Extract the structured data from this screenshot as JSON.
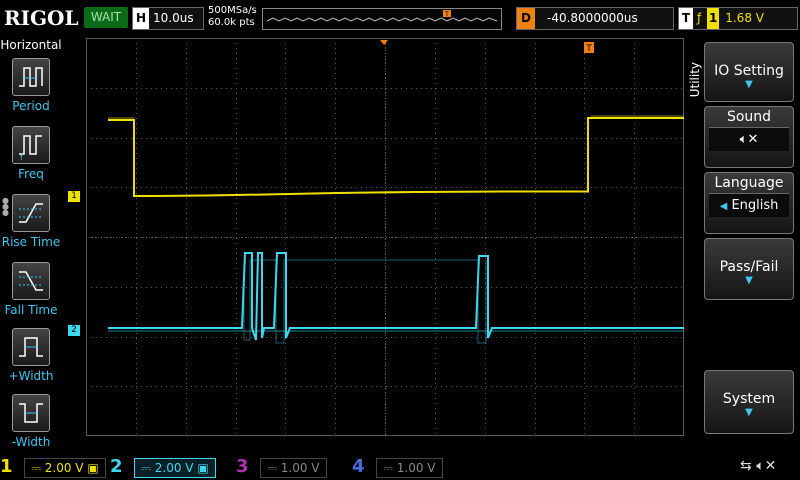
{
  "brand": "RIGOL",
  "status": "WAIT",
  "timebase": {
    "label": "H",
    "value": "10.0us"
  },
  "sampling": {
    "rate": "500MSa/s",
    "points": "60.0k pts"
  },
  "delay": {
    "label": "D",
    "value": "-40.8000000us"
  },
  "trigger": {
    "label": "T",
    "channel": "1",
    "level": "1.68 V"
  },
  "left_menu": {
    "title": "Horizontal",
    "items": [
      {
        "label": "Period",
        "icon": "period-icon"
      },
      {
        "label": "Freq",
        "icon": "freq-icon"
      },
      {
        "label": "Rise Time",
        "icon": "rise-time-icon"
      },
      {
        "label": "Fall Time",
        "icon": "fall-time-icon"
      },
      {
        "label": "+Width",
        "icon": "pos-width-icon"
      },
      {
        "label": "-Width",
        "icon": "neg-width-icon"
      }
    ]
  },
  "right_menu": {
    "title": "Utility",
    "io_setting": "IO Setting",
    "sound": "Sound",
    "language": {
      "label": "Language",
      "value": "English"
    },
    "pass_fail": "Pass/Fail",
    "system": "System"
  },
  "channels": [
    {
      "num": "1",
      "value": "2.00 V",
      "active": true
    },
    {
      "num": "2",
      "value": "2.00 V",
      "active": true
    },
    {
      "num": "3",
      "value": "1.00 V",
      "active": false
    },
    {
      "num": "4",
      "value": "1.00 V",
      "active": false
    }
  ],
  "markers": {
    "ch1": "1",
    "ch2": "2",
    "trig": "T"
  },
  "colors": {
    "ch1": "#f0e000",
    "ch2": "#3cd8f0",
    "grid": "#5a5a5a",
    "trigger": "#f08010"
  }
}
